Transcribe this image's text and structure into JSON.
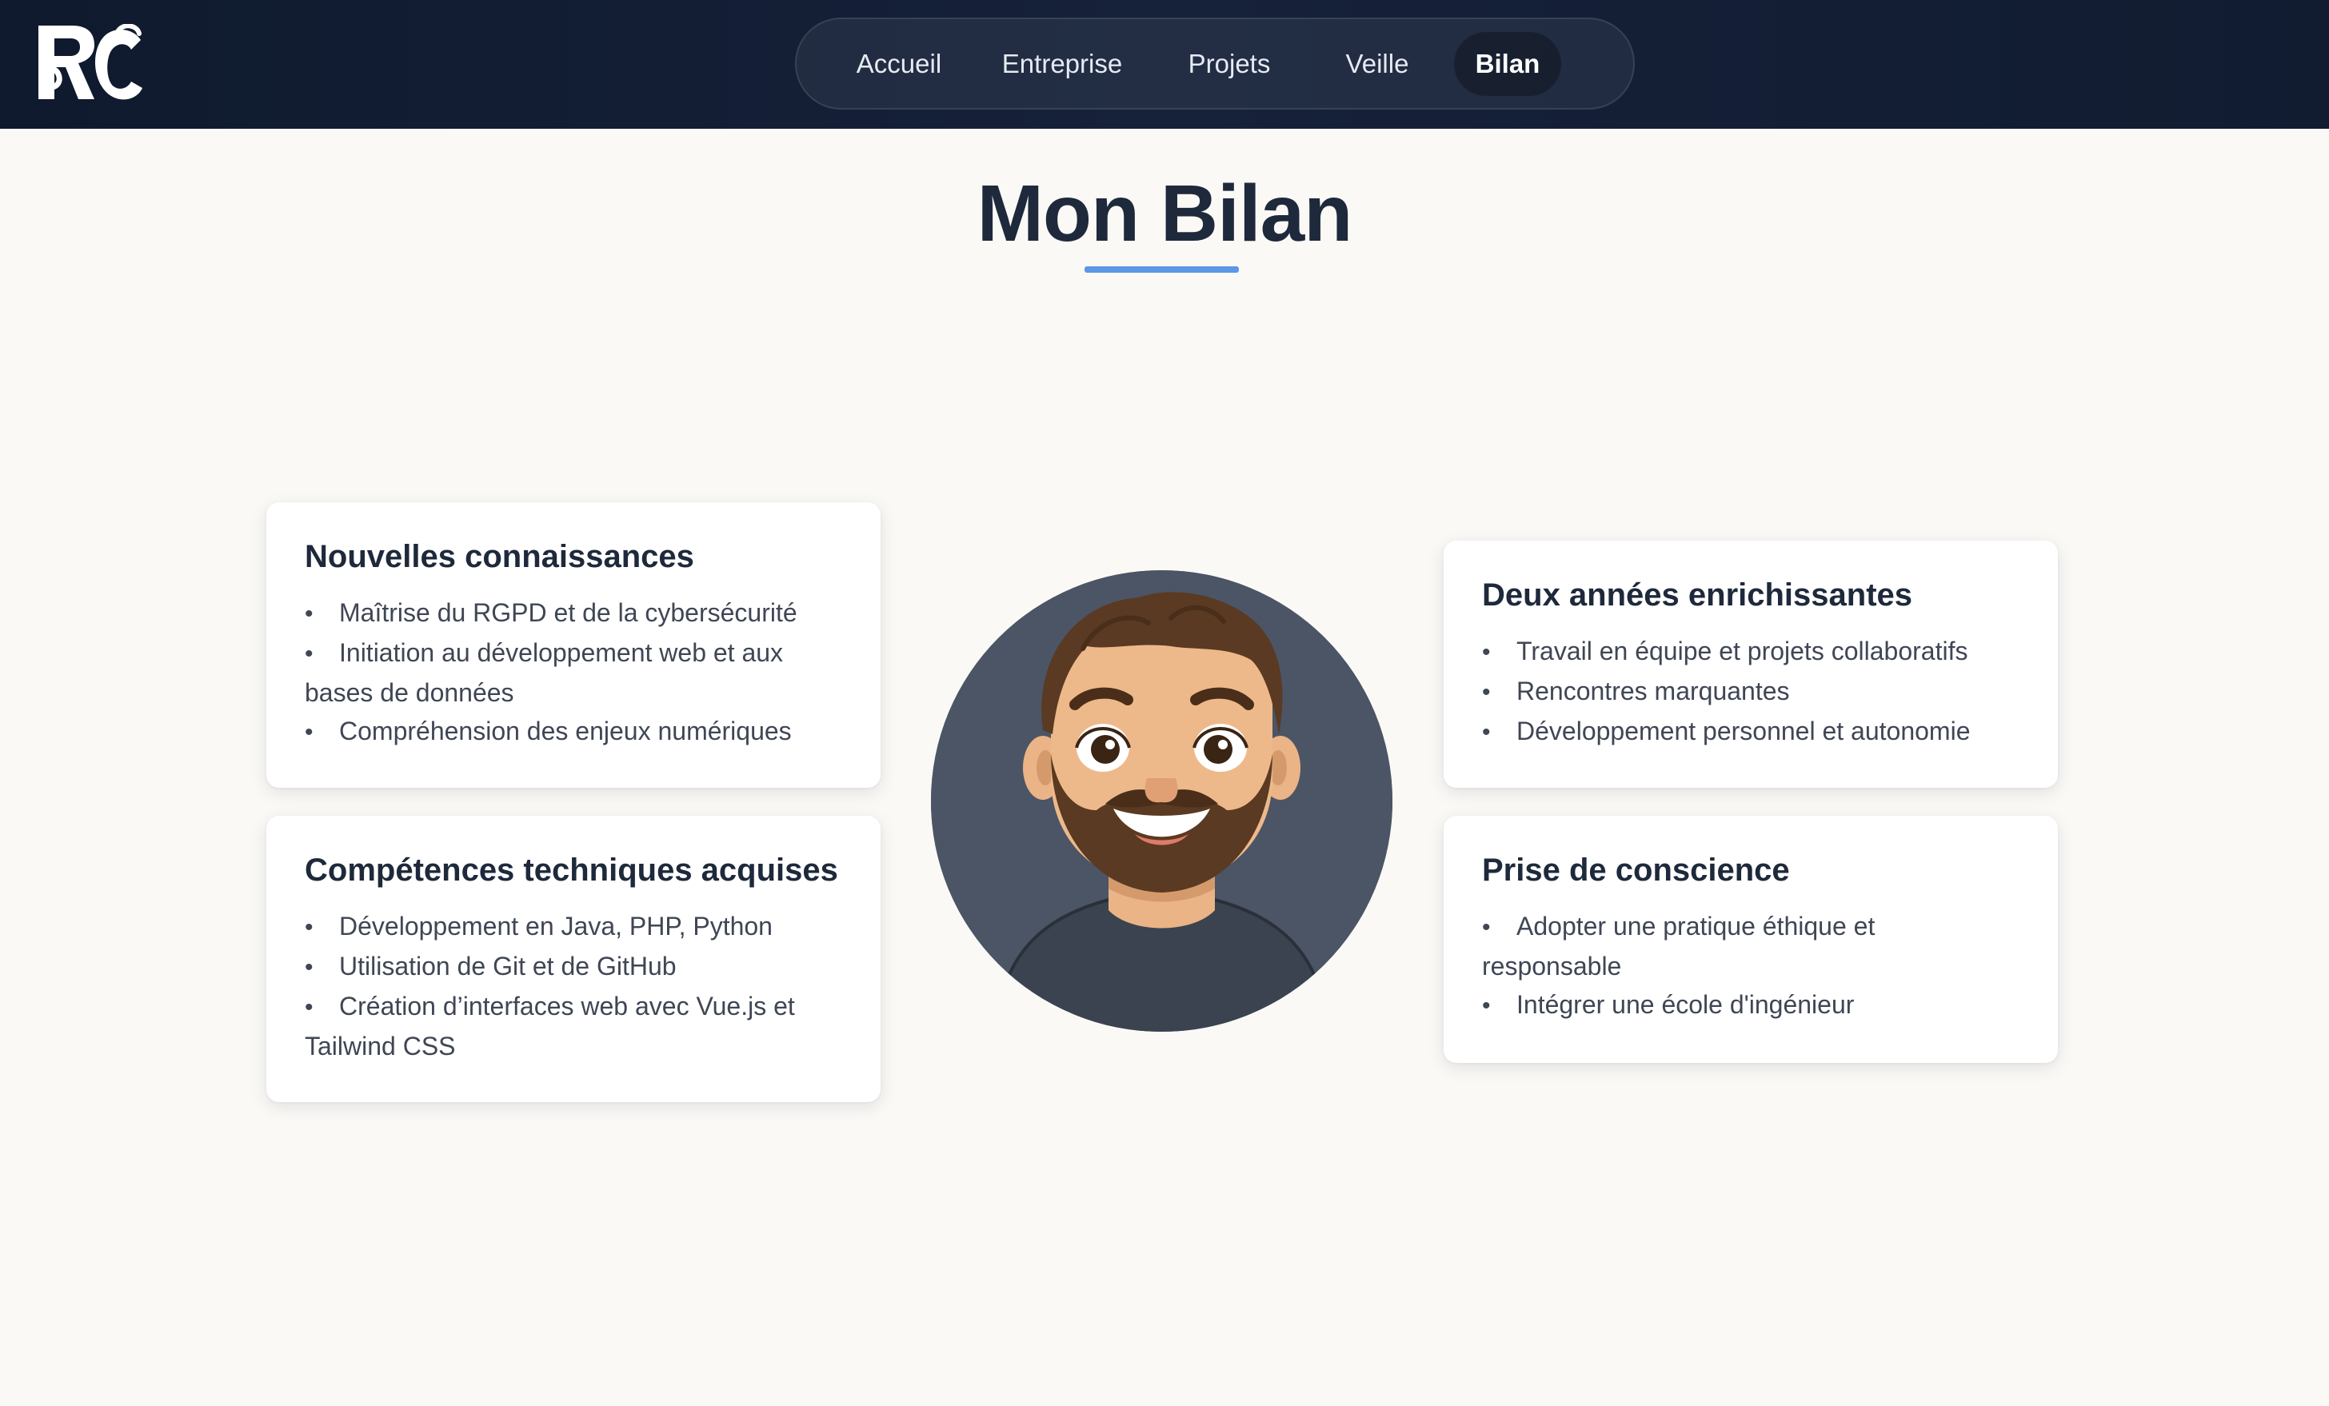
{
  "logo": {
    "text": "RC",
    "icon": "rc-monogram-logo"
  },
  "nav": {
    "items": [
      {
        "label": "Accueil",
        "active": false
      },
      {
        "label": "Entreprise",
        "active": false
      },
      {
        "label": "Projets",
        "active": false
      },
      {
        "label": "Veille",
        "active": false
      },
      {
        "label": "Bilan",
        "active": true
      }
    ]
  },
  "page": {
    "title": "Mon Bilan",
    "accent_color": "#5e97e6"
  },
  "cards": {
    "nouvelles": {
      "title": "Nouvelles connaissances",
      "items": [
        "Maîtrise du RGPD et de la cybersécurité",
        "Initiation au développement web et aux bases de données",
        "Compréhension des enjeux numériques"
      ]
    },
    "competences": {
      "title": "Compétences techniques acquises",
      "items": [
        "Développement en Java, PHP, Python",
        "Utilisation de Git et de GitHub",
        "Création d’interfaces web avec Vue.js et Tailwind CSS"
      ]
    },
    "deux_annees": {
      "title": "Deux années enrichissantes",
      "items": [
        "Travail en équipe et projets collaboratifs",
        "Rencontres marquantes",
        "Développement personnel et autonomie"
      ]
    },
    "prise_conscience": {
      "title": "Prise de conscience",
      "items": [
        "Adopter une pratique éthique et responsable",
        "Intégrer une école d'ingénieur"
      ]
    }
  },
  "avatar": {
    "icon": "bearded-man-avatar"
  }
}
